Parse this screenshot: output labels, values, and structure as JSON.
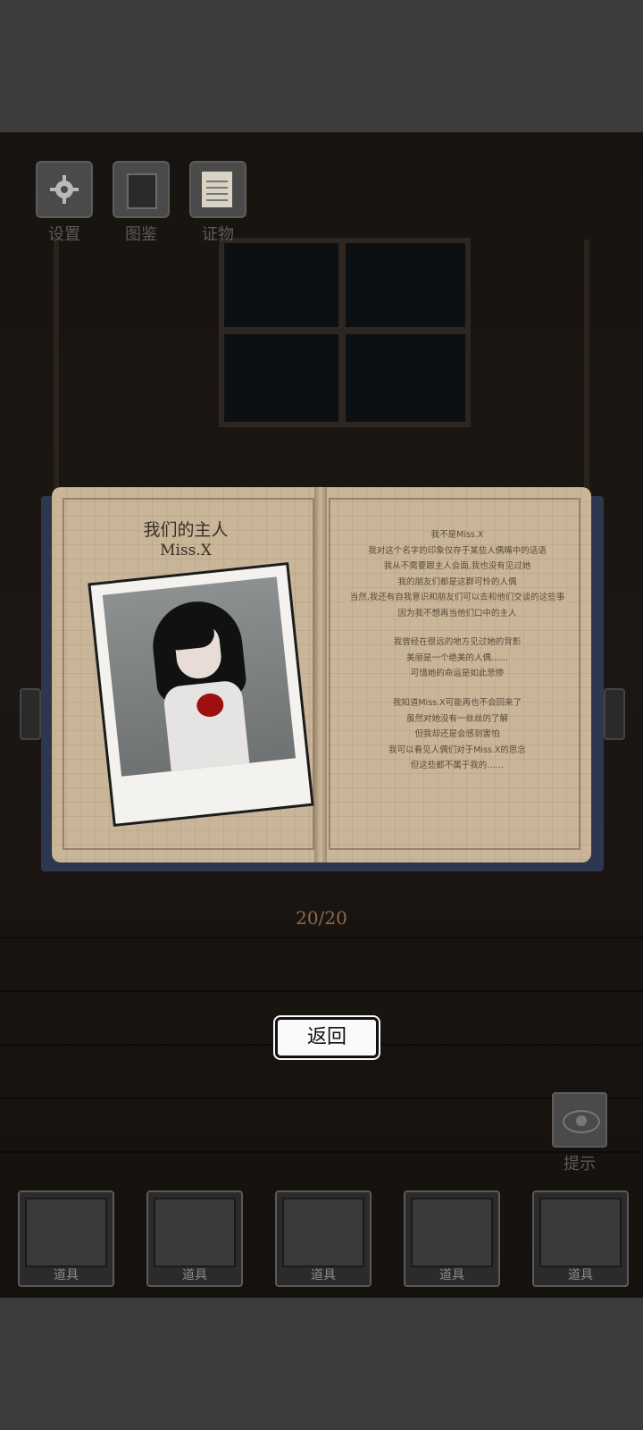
{
  "toolbar": {
    "settings_label": "设置",
    "gallery_label": "图鉴",
    "evidence_label": "证物"
  },
  "book": {
    "left_page": {
      "title": "我们的主人",
      "subtitle": "Miss.X"
    },
    "right_page": {
      "paragraph1": [
        "我不是Miss.X",
        "我对这个名字的印象仅存于某些人偶嘴中的话语",
        "我从不需要跟主人会面,我也没有见过她",
        "我的朋友们都是这群可怜的人偶",
        "当然,我还有自我意识和朋友们可以去和他们交谈的这些事",
        "因为我不想再当他们口中的主人"
      ],
      "paragraph2": [
        "我曾经在很远的地方见过她的背影",
        "美丽是一个绝美的人偶……",
        "可惜她的命运是如此悲惨"
      ],
      "paragraph3": [
        "我知道Miss.X可能再也不会回来了",
        "虽然对她没有一丝丝的了解",
        "但我却还是会感到害怕",
        "我可以看见人偶们对于Miss.X的思念",
        "但这些都不属于我的……"
      ]
    },
    "pager": "20/20"
  },
  "back_button_label": "返回",
  "hint": {
    "label": "提示",
    "icon": "eye-icon"
  },
  "inventory": {
    "slots": [
      {
        "label": "道具"
      },
      {
        "label": "道具"
      },
      {
        "label": "道具"
      },
      {
        "label": "道具"
      },
      {
        "label": "道具"
      }
    ]
  },
  "colors": {
    "background_bar": "#3c3c3c",
    "page": "#c9b597",
    "cover": "#2d3850",
    "pager_text": "#8a6a50"
  }
}
